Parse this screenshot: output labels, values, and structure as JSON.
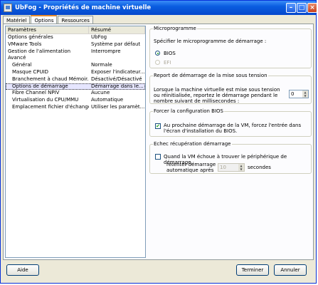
{
  "window": {
    "title": "UbFog - Propriétés de machine virtuelle"
  },
  "tabs": [
    {
      "label": "Matériel"
    },
    {
      "label": "Options"
    },
    {
      "label": "Ressources"
    }
  ],
  "list": {
    "headers": [
      "Paramètres",
      "Résumé"
    ],
    "rows": [
      {
        "name": "Options générales",
        "value": "UbFog"
      },
      {
        "name": "VMware Tools",
        "value": "Système par défaut"
      },
      {
        "name": "Gestion de l'alimentation",
        "value": "Interrompre"
      },
      {
        "name": "Avancé",
        "value": ""
      },
      {
        "name": "Général",
        "value": "Normale"
      },
      {
        "name": "Masque CPUID",
        "value": "Exposer l'indicateur..."
      },
      {
        "name": "Branchement à chaud Mémoir...",
        "value": "Désactivé/Désactivé"
      },
      {
        "name": "Options de démarrage",
        "value": "Démarrage dans le..."
      },
      {
        "name": "Fibre Channel NPIV",
        "value": "Aucune"
      },
      {
        "name": "Virtualisation du CPU/MMU",
        "value": "Automatique"
      },
      {
        "name": "Emplacement fichier d'échange",
        "value": "Utiliser les paramèt..."
      }
    ]
  },
  "firmware": {
    "legend": "Microprogramme",
    "label": "Spécifier le microprogramme de démarrage :",
    "opt_bios": "BIOS",
    "opt_efi": "EFI"
  },
  "power_delay": {
    "legend": "Report de démarrage de la mise sous tension",
    "text": "Lorsque la machine virtuelle est mise sous tension ou réinitialisée, reportez le démarrage pendant le nombre suivant de millisecondes :",
    "value": "0"
  },
  "force_bios": {
    "legend": "Forcer la configuration BIOS",
    "text": "Au prochaine démarrage de la VM, forcez l'entrée dans l'écran d'installation du BIOS."
  },
  "recovery": {
    "legend": "Echec récupération démarrage",
    "checkbox_label": "Quand la VM échoue à trouver le périphérique de démarrage,",
    "retry_label": "retenter démarrage automatique après",
    "retry_value": "10",
    "unit": "secondes"
  },
  "buttons": {
    "help": "Aide",
    "finish": "Terminer",
    "cancel": "Annuler"
  }
}
